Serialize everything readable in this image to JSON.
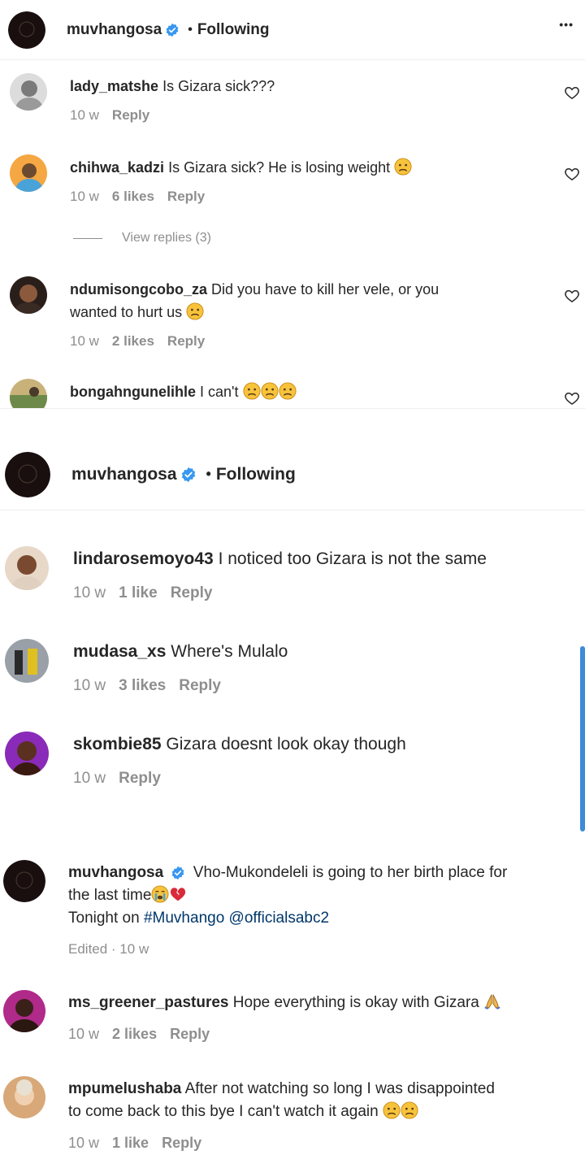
{
  "panel1": {
    "header": {
      "username": "muvhangosa",
      "separator": "•",
      "follow_label": "Following",
      "more_label": "•••"
    },
    "comments": [
      {
        "username": "lady_matshe",
        "text": "Is Gizara sick???",
        "time": "10 w",
        "likes": "",
        "reply": "Reply"
      },
      {
        "username": "chihwa_kadzi",
        "text": "Is Gizara sick? He is losing weight",
        "time": "10 w",
        "likes": "6 likes",
        "reply": "Reply"
      },
      {
        "username": "ndumisongcobo_za",
        "text": "Did you have to kill her vele, or you",
        "text2": "wanted to hurt us",
        "time": "10 w",
        "likes": "2 likes",
        "reply": "Reply"
      },
      {
        "username": "bongahngunelihle",
        "text": "I can't"
      }
    ],
    "view_replies": "View replies (3)"
  },
  "panel2": {
    "header": {
      "username": "muvhangosa",
      "separator": "•",
      "follow_label": "Following"
    },
    "comments": [
      {
        "username": "lindarosemoyo43",
        "text": "I noticed too Gizara is not the same",
        "time": "10 w",
        "likes": "1 like",
        "reply": "Reply"
      },
      {
        "username": "mudasa_xs",
        "text": "Where's Mulalo",
        "time": "10 w",
        "likes": "3 likes",
        "reply": "Reply"
      },
      {
        "username": "skombie85",
        "text": "Gizara doesnt look okay though",
        "time": "10 w",
        "likes": "",
        "reply": "Reply"
      }
    ]
  },
  "panel3": {
    "caption": {
      "username": "muvhangosa",
      "text": "Vho-Mukondeleli is going to her birth place for",
      "text2": "the last time",
      "text3_prefix": "Tonight on",
      "hashtag": "#Muvhango",
      "mention": "@officialsabc2",
      "meta": "Edited · 10 w"
    },
    "comments": [
      {
        "username": "ms_greener_pastures",
        "text": "Hope everything is okay with Gizara",
        "time": "10 w",
        "likes": "2 likes",
        "reply": "Reply"
      },
      {
        "username": "mpumelushaba",
        "text": "After not watching so long I was disappointed",
        "text2": "to come back to this bye I can't watch it again",
        "time": "10 w",
        "likes": "1 like",
        "reply": "Reply"
      }
    ]
  },
  "icons": {
    "verified": "verified-badge-icon",
    "heart": "heart-outline-icon",
    "sad_emoji": "sad-face-emoji-icon",
    "crying_emoji": "crying-face-emoji-icon",
    "broken_heart": "broken-heart-emoji-icon",
    "pray": "folded-hands-emoji-icon"
  },
  "colors": {
    "verified": "#3897f0",
    "muted": "#8e8e8e",
    "link": "#00376b",
    "scrollbar": "#3d8bd9"
  }
}
